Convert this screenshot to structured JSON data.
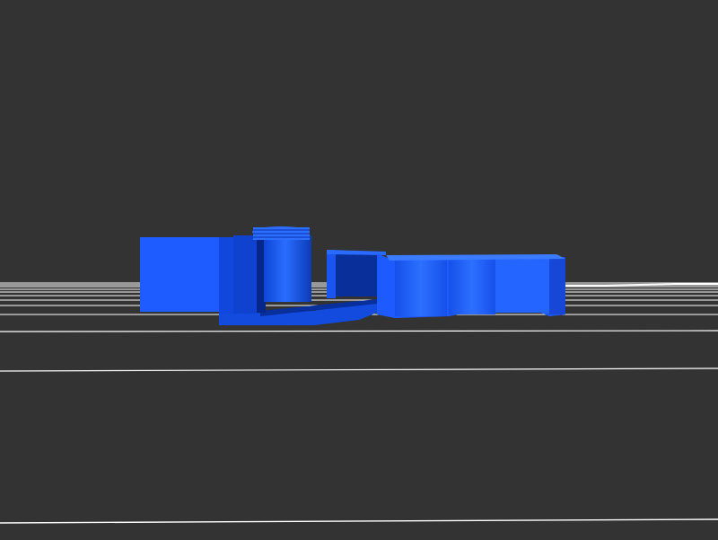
{
  "viewer": {
    "background_color": "#333333",
    "grid_color": "#ffffff",
    "model_color": "#1a5fff",
    "model_shade_dark": "#0b3fc4",
    "model_shade_light": "#3b7bff",
    "view": "side-elevation",
    "model": "blue-hinged-clip-part"
  }
}
